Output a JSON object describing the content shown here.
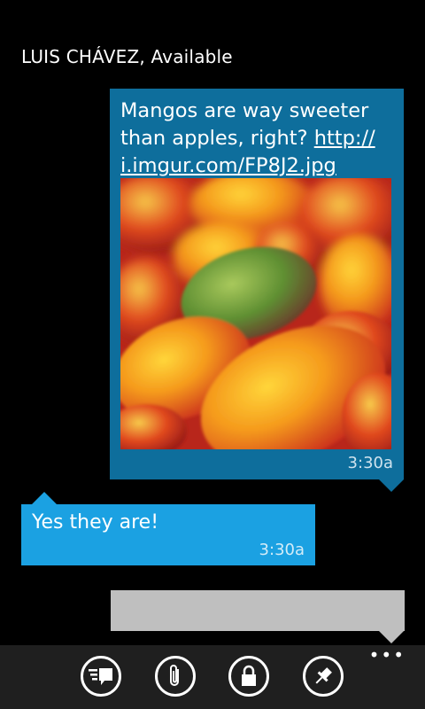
{
  "header": {
    "contact": "LUIS CHÁVEZ, Available"
  },
  "outgoing": {
    "text_before": "Mangos are way sweeter than apples, right? ",
    "link": "http:// i.imgur.com/FP8J2.jpg",
    "image_alt": "mangos photo",
    "time": "3:30a",
    "color": "#0e6e9c"
  },
  "incoming": {
    "text": "Yes they are!",
    "time": "3:30a",
    "color": "#1ba1e2"
  },
  "compose": {
    "placeholder": ""
  },
  "appbar": {
    "buttons": [
      {
        "icon": "messages-icon"
      },
      {
        "icon": "attach-icon"
      },
      {
        "icon": "lock-icon"
      },
      {
        "icon": "pin-icon"
      }
    ],
    "more": "•••"
  }
}
